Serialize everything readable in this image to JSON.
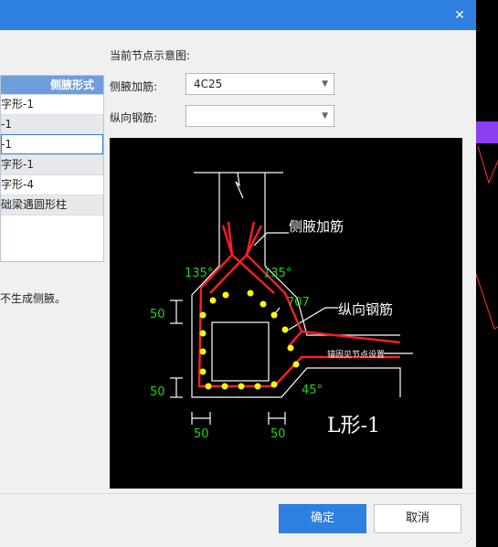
{
  "dialog": {
    "close_glyph": "✕"
  },
  "left_table": {
    "header": "侧腋形式",
    "rows": [
      "字形-1",
      "-1",
      "-1",
      "字形-1",
      "字形-4",
      "础梁遇圆形柱"
    ]
  },
  "left_note": "不生成侧腋。",
  "preview": {
    "title": "当前节点示意图:",
    "haunch_rebar_label": "侧腋加筋:",
    "haunch_rebar_value": "4C25",
    "longitudinal_rebar_label": "纵向钢筋:",
    "longitudinal_rebar_value": ""
  },
  "diagram_text": {
    "haunch_rebar": "侧腋加筋",
    "longitudinal_rebar": "纵向钢筋",
    "angle_left": "135°",
    "angle_right": "135°",
    "dim_707": "707",
    "dim_50_top": "50",
    "dim_50_bottom": "50",
    "dim_50_left": "50",
    "dim_50_right": "50",
    "angle_45": "45°",
    "anchor_note": "锚固见节点设置",
    "shape_name": "L形-1"
  },
  "buttons": {
    "ok": "确定",
    "cancel": "取消"
  },
  "colors": {
    "title_bar": "#2d7fe0",
    "header_blue": "#6f9edc",
    "rebar_red": "#ff1f1f",
    "dot_yellow": "#ffff00",
    "dim_green": "#1fd51f",
    "side_purple": "#8b3ff0"
  }
}
